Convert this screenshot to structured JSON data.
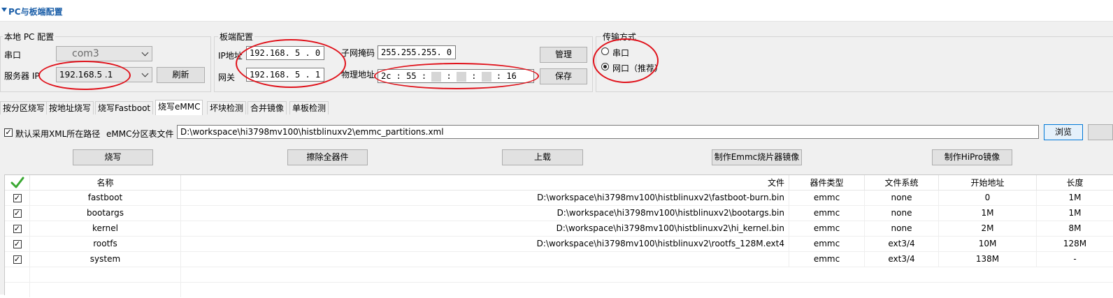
{
  "header": {
    "title": "PC与板端配置"
  },
  "pc_config": {
    "group_label": "本地 PC 配置",
    "serial_label": "串口",
    "serial_value": "com3",
    "server_ip_label": "服务器 IP",
    "server_ip_value": "192.168.5 .1",
    "refresh_label": "刷新"
  },
  "board_config": {
    "group_label": "板端配置",
    "ip_label": "IP地址",
    "ip_value": "192.168. 5 . 0",
    "gateway_label": "网关",
    "gateway_value": "192.168. 5 . 1",
    "mask_label": "子网掩码",
    "mask_value": "255.255.255. 0",
    "mac_label": "物理地址",
    "mac_parts": [
      "2c",
      "55",
      "16"
    ],
    "manage_label": "管理",
    "save_label": "保存"
  },
  "transfer": {
    "group_label": "传输方式",
    "options": [
      {
        "label": "串口",
        "selected": false
      },
      {
        "label": "网口（推荐）",
        "selected": true
      }
    ]
  },
  "tabs": [
    {
      "label": "按分区烧写",
      "active": false
    },
    {
      "label": "按地址烧写",
      "active": false
    },
    {
      "label": "烧写Fastboot",
      "active": false
    },
    {
      "label": "烧写eMMC",
      "active": true
    },
    {
      "label": "坏块检测",
      "active": false
    },
    {
      "label": "合并镜像",
      "active": false
    },
    {
      "label": "单板检测",
      "active": false
    }
  ],
  "emmc": {
    "use_xml_path_label": "默认采用XML所在路径",
    "use_xml_path_checked": true,
    "partition_file_label": "eMMC分区表文件",
    "partition_file_value": "D:\\workspace\\hi3798mv100\\histblinuxv2\\emmc_partitions.xml",
    "browse_label": "浏览",
    "burn_label": "烧写",
    "erase_label": "擦除全器件",
    "upload_label": "上载",
    "make_emmc_image_label": "制作Emmc烧片器镜像",
    "make_hipro_image_label": "制作HiPro镜像"
  },
  "table": {
    "columns": [
      "名称",
      "文件",
      "器件类型",
      "文件系统",
      "开始地址",
      "长度"
    ],
    "rows": [
      {
        "checked": true,
        "name": "fastboot",
        "file": "D:\\workspace\\hi3798mv100\\histblinuxv2\\fastboot-burn.bin",
        "device": "emmc",
        "fs": "none",
        "start": "0",
        "length": "1M"
      },
      {
        "checked": true,
        "name": "bootargs",
        "file": "D:\\workspace\\hi3798mv100\\histblinuxv2\\bootargs.bin",
        "device": "emmc",
        "fs": "none",
        "start": "1M",
        "length": "1M"
      },
      {
        "checked": true,
        "name": "kernel",
        "file": "D:\\workspace\\hi3798mv100\\histblinuxv2\\hi_kernel.bin",
        "device": "emmc",
        "fs": "none",
        "start": "2M",
        "length": "8M"
      },
      {
        "checked": true,
        "name": "rootfs",
        "file": "D:\\workspace\\hi3798mv100\\histblinuxv2\\rootfs_128M.ext4",
        "device": "emmc",
        "fs": "ext3/4",
        "start": "10M",
        "length": "128M"
      },
      {
        "checked": true,
        "name": "system",
        "file": "",
        "device": "emmc",
        "fs": "ext3/4",
        "start": "138M",
        "length": "-"
      }
    ]
  },
  "colors": {
    "accent": "#1a5ea8",
    "annotation": "#e0121b",
    "check": "#3aa832"
  },
  "icons": [
    "chevron-down-icon",
    "check-all-icon",
    "checkbox-icon",
    "radio-icon",
    "collapse-triangle-icon"
  ]
}
